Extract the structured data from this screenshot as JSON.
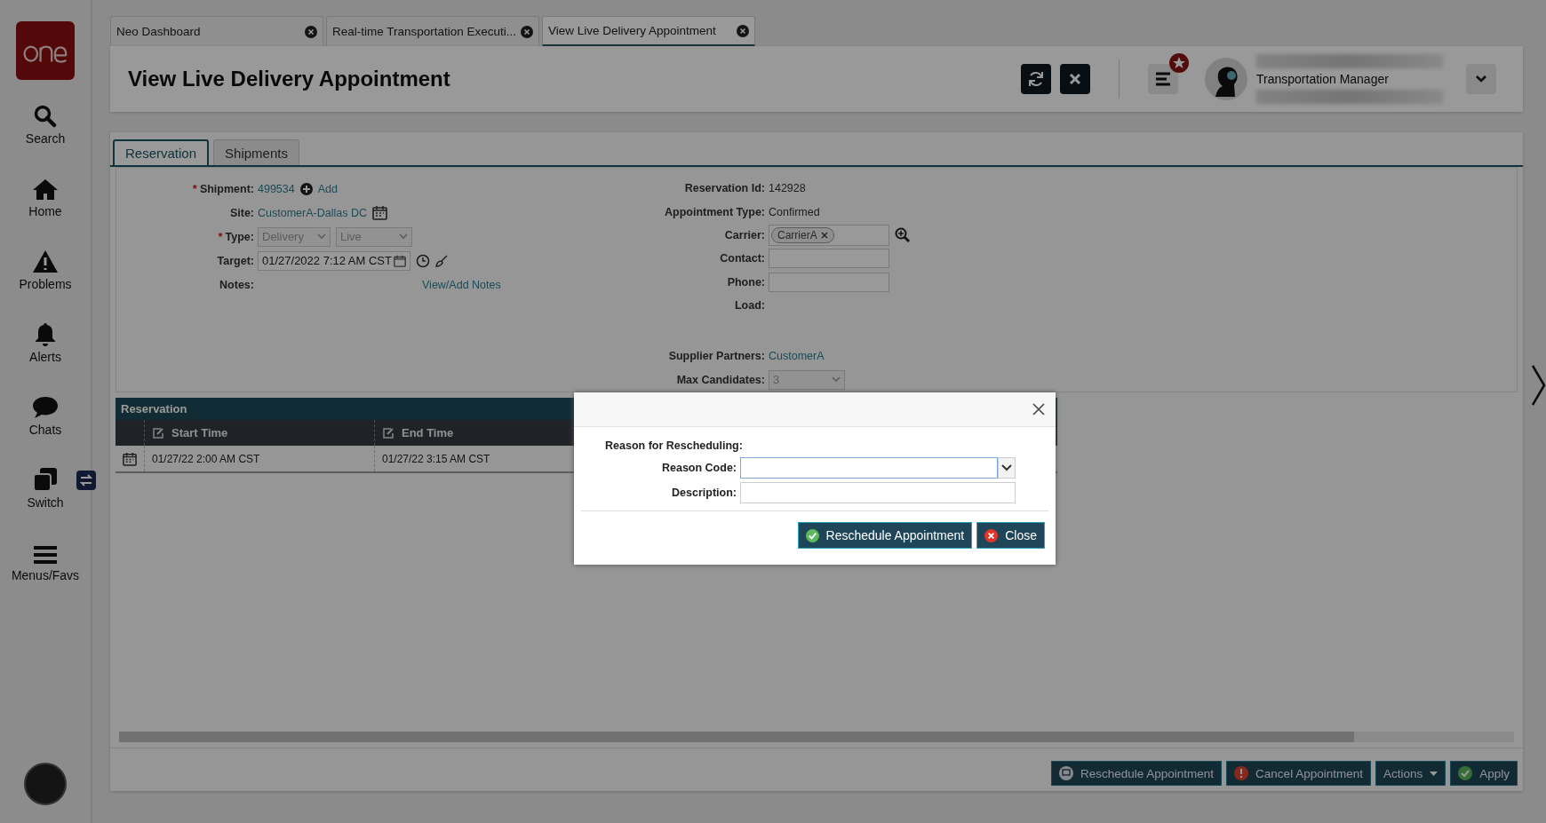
{
  "sidebar": {
    "items": [
      {
        "label": "Search",
        "kind": "search"
      },
      {
        "label": "Home",
        "kind": "home"
      },
      {
        "label": "Problems",
        "kind": "problems"
      },
      {
        "label": "Alerts",
        "kind": "alerts"
      },
      {
        "label": "Chats",
        "kind": "chats"
      },
      {
        "label": "Switch",
        "kind": "switch"
      },
      {
        "label": "Menus/Favs",
        "kind": "menu"
      }
    ]
  },
  "tabs": [
    {
      "label": "Neo Dashboard",
      "selected": false
    },
    {
      "label": "Real-time Transportation Executi...",
      "selected": false
    },
    {
      "label": "View Live Delivery Appointment",
      "selected": true
    }
  ],
  "header": {
    "title": "View Live Delivery Appointment",
    "user_role": "Transportation Manager"
  },
  "content_tabs": [
    {
      "label": "Reservation",
      "selected": true
    },
    {
      "label": "Shipments",
      "selected": false
    }
  ],
  "left_fields": [
    {
      "label": "Shipment:",
      "marker": "*",
      "kind": "shipment",
      "value": "499534",
      "action": "Add"
    },
    {
      "label": "Site:",
      "kind": "site",
      "value": "CustomerA-Dallas DC"
    },
    {
      "label": "Type:",
      "marker": "*",
      "kind": "selects",
      "values": [
        "Delivery",
        "Live"
      ]
    },
    {
      "label": "Target:",
      "kind": "datetime",
      "value": "01/27/2022 7:12 AM CST"
    },
    {
      "label": "Notes:",
      "kind": "notes",
      "value": "View/Add Notes"
    }
  ],
  "right_fields": [
    {
      "label": "Reservation Id:",
      "kind": "text",
      "value": "142928"
    },
    {
      "label": "Appointment Type:",
      "kind": "text",
      "value": "Confirmed"
    },
    {
      "label": "Carrier:",
      "kind": "chip",
      "value": "CarrierA"
    },
    {
      "label": "Contact:",
      "kind": "input"
    },
    {
      "label": "Phone:",
      "kind": "input"
    },
    {
      "label": "Load:",
      "kind": "text"
    },
    {
      "label": "Supplier Partners:",
      "kind": "link",
      "value": "CustomerA"
    },
    {
      "label": "Max Candidates:",
      "kind": "select",
      "value": "3"
    }
  ],
  "grid": {
    "title": "Reservation",
    "columns": [
      "Start Time",
      "End Time"
    ],
    "rows": [
      [
        "01/27/22 2:00 AM CST",
        "01/27/22 3:15 AM CST"
      ]
    ]
  },
  "dialog": {
    "heading": "Reason for Rescheduling:",
    "fields": [
      {
        "label": "Reason Code:",
        "kind": "select"
      },
      {
        "label": "Description:",
        "kind": "text"
      }
    ],
    "buttons": [
      {
        "label": "Reschedule Appointment",
        "kind": "confirm"
      },
      {
        "label": "Close",
        "kind": "cancel"
      }
    ]
  },
  "footer_buttons": [
    {
      "label": "Reschedule Appointment",
      "kind": "reschedule"
    },
    {
      "label": "Cancel Appointment",
      "kind": "cancel"
    },
    {
      "label": "Actions",
      "kind": "menu"
    },
    {
      "label": "Apply",
      "kind": "apply"
    }
  ]
}
